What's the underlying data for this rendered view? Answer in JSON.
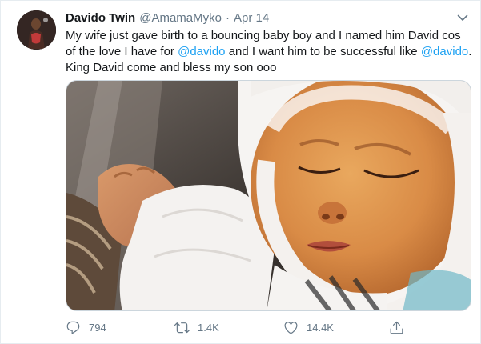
{
  "tweet": {
    "display_name": "Davido Twin",
    "handle": "@AmamaMyko",
    "separator": "·",
    "date": "Apr 14",
    "text": {
      "part1": "My wife just gave birth to a bouncing baby boy and I named him David cos of the love I have for ",
      "mention1": "@davido",
      "part2": " and I want him to be successful like ",
      "mention2": "@davido",
      "part3": ". King David come and bless my son ooo"
    },
    "media_description": "photo-of-sleeping-newborn-baby",
    "actions": {
      "reply_count": "794",
      "retweet_count": "1.4K",
      "like_count": "14.4K"
    }
  },
  "colors": {
    "text_primary": "#14171a",
    "text_secondary": "#657786",
    "link": "#1da1f2",
    "border": "#e6ecf0"
  },
  "icons": {
    "caret": "chevron-down-icon",
    "reply": "reply-icon",
    "retweet": "retweet-icon",
    "like": "heart-icon",
    "share": "share-icon"
  }
}
